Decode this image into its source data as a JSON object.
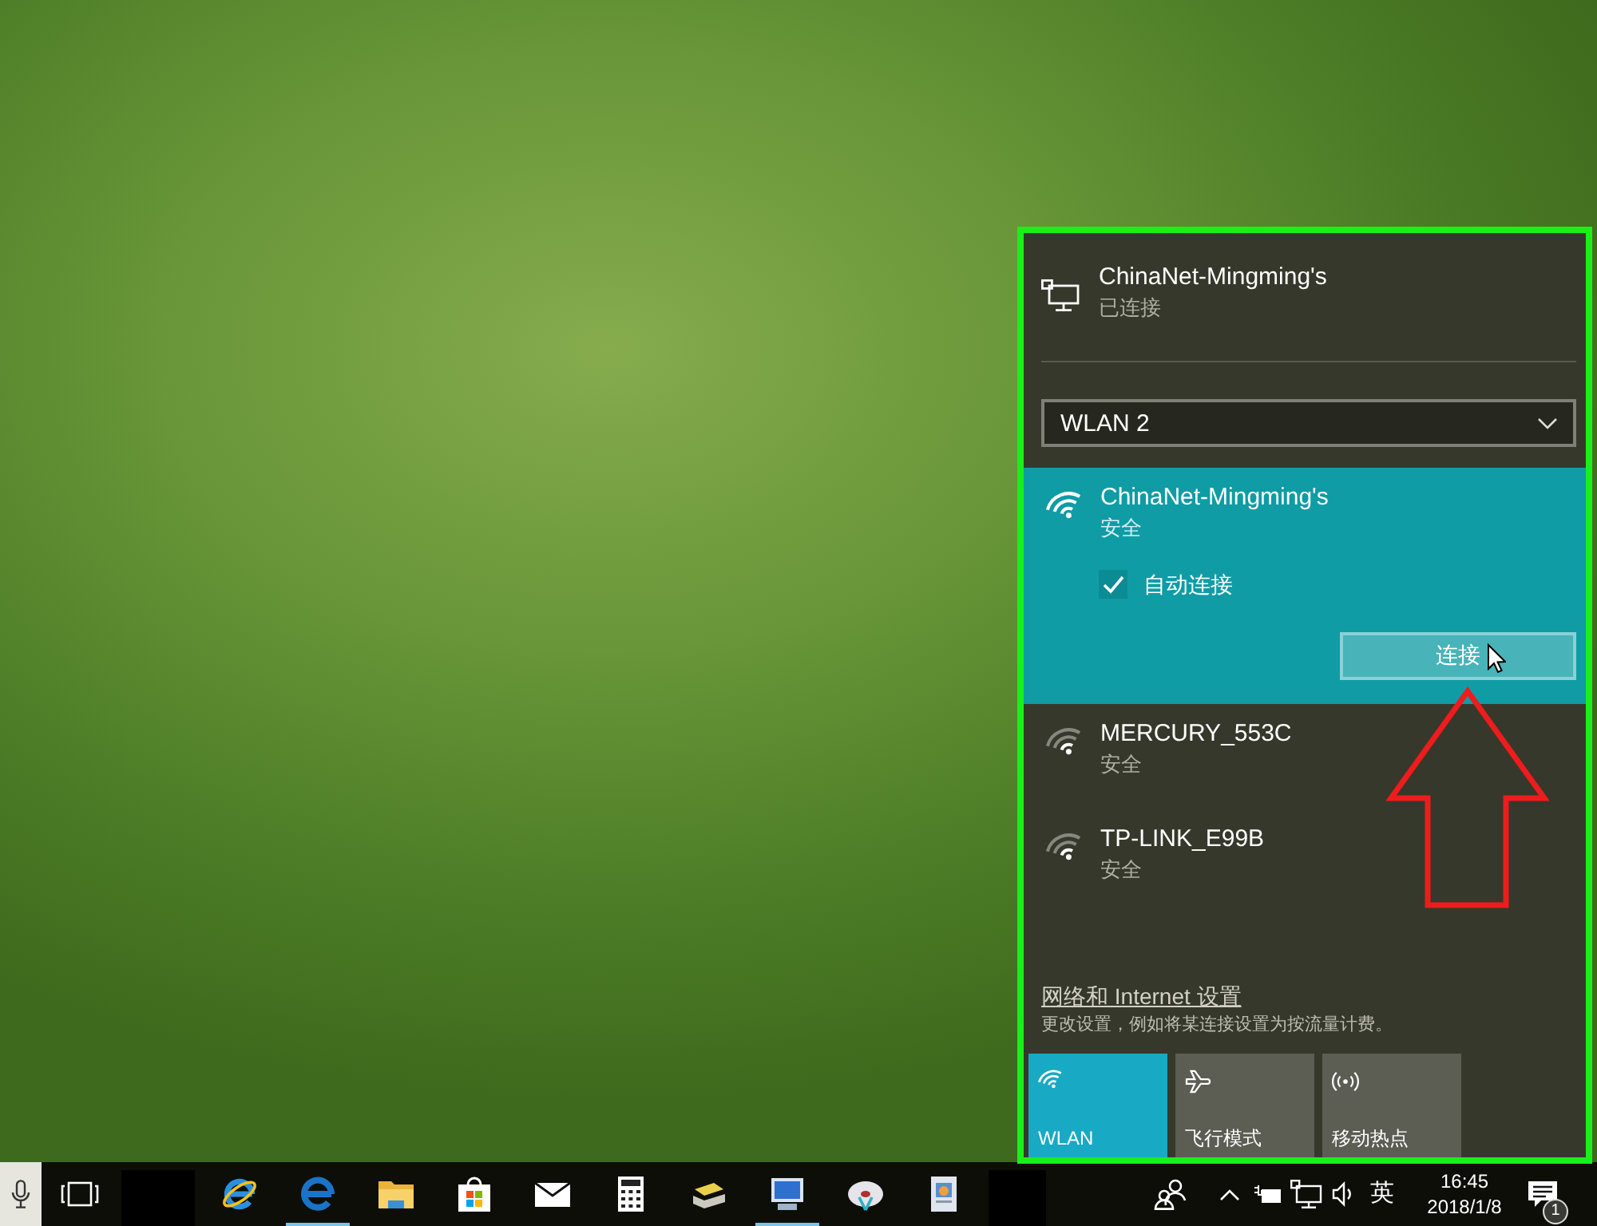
{
  "network_flyout": {
    "connection": {
      "name": "ChinaNet-Mingming's",
      "status": "已连接"
    },
    "adapter_dropdown": {
      "value": "WLAN 2"
    },
    "networks": [
      {
        "name": "ChinaNet-Mingming's",
        "security": "安全",
        "selected": true,
        "auto_connect": {
          "label": "自动连接",
          "checked": true
        },
        "connect_button": "连接"
      },
      {
        "name": "MERCURY_553C",
        "security": "安全",
        "selected": false
      },
      {
        "name": "TP-LINK_E99B",
        "security": "安全",
        "selected": false
      }
    ],
    "settings": {
      "link": "网络和 Internet 设置",
      "hint": "更改设置，例如将某连接设置为按流量计费。"
    },
    "quick_actions": [
      {
        "kind": "wlan",
        "label": "WLAN",
        "on": true
      },
      {
        "kind": "airplane",
        "label": "飞行模式",
        "on": false
      },
      {
        "kind": "hotspot",
        "label": "移动热点",
        "on": false
      }
    ]
  },
  "taskbar": {
    "apps": [
      {
        "kind": "ie",
        "running": false
      },
      {
        "kind": "edge",
        "running": true
      },
      {
        "kind": "explorer",
        "running": false
      },
      {
        "kind": "store",
        "running": false
      },
      {
        "kind": "mail",
        "running": false
      },
      {
        "kind": "calculator",
        "running": false
      },
      {
        "kind": "scanner",
        "running": false
      },
      {
        "kind": "monitor",
        "running": true
      },
      {
        "kind": "disc",
        "running": false
      },
      {
        "kind": "document",
        "running": false
      }
    ],
    "tray": {
      "input_language": "英",
      "time": "16:45",
      "date": "2018/1/8",
      "notifications": "1"
    }
  }
}
